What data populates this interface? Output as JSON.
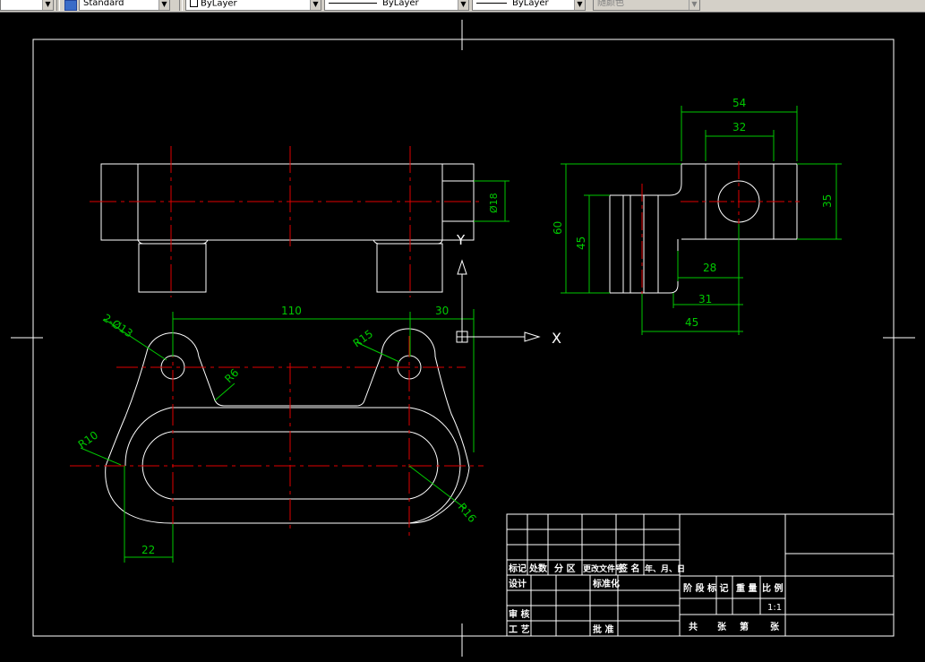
{
  "toolbar": {
    "textstyle_value": "Standard",
    "layer_value": "ByLayer",
    "linetype_value": "ByLayer",
    "lineweight_value": "ByLayer",
    "color_value": "随颜色"
  },
  "ucs": {
    "x_label": "X",
    "y_label": "Y"
  },
  "dimensions": {
    "top_dia": "Ø18",
    "right_54": "54",
    "right_32": "32",
    "right_35": "35",
    "right_60": "60",
    "right_45v": "45",
    "right_28": "28",
    "right_31": "31",
    "right_45h": "45",
    "plan_110": "110",
    "plan_30": "30",
    "plan_holes": "2-Ø13",
    "plan_r6": "R6",
    "plan_r15": "R15",
    "plan_r10": "R10",
    "plan_r16": "R16",
    "plan_22": "22"
  },
  "title_block": {
    "marker": "标记",
    "count": "处数",
    "zone": "分 区",
    "change_doc": "更改文件号",
    "signature": "签 名",
    "date": "年、月、日",
    "design": "设计",
    "standardize": "标准化",
    "stage_mark": "阶 段 标 记",
    "weight": "重 量",
    "scale": "比 例",
    "scale_value": "1:1",
    "review": "审 核",
    "process": "工 艺",
    "approve": "批 准",
    "total": "共",
    "sheet_unit1": "张",
    "page": "第",
    "sheet_unit2": "张"
  }
}
